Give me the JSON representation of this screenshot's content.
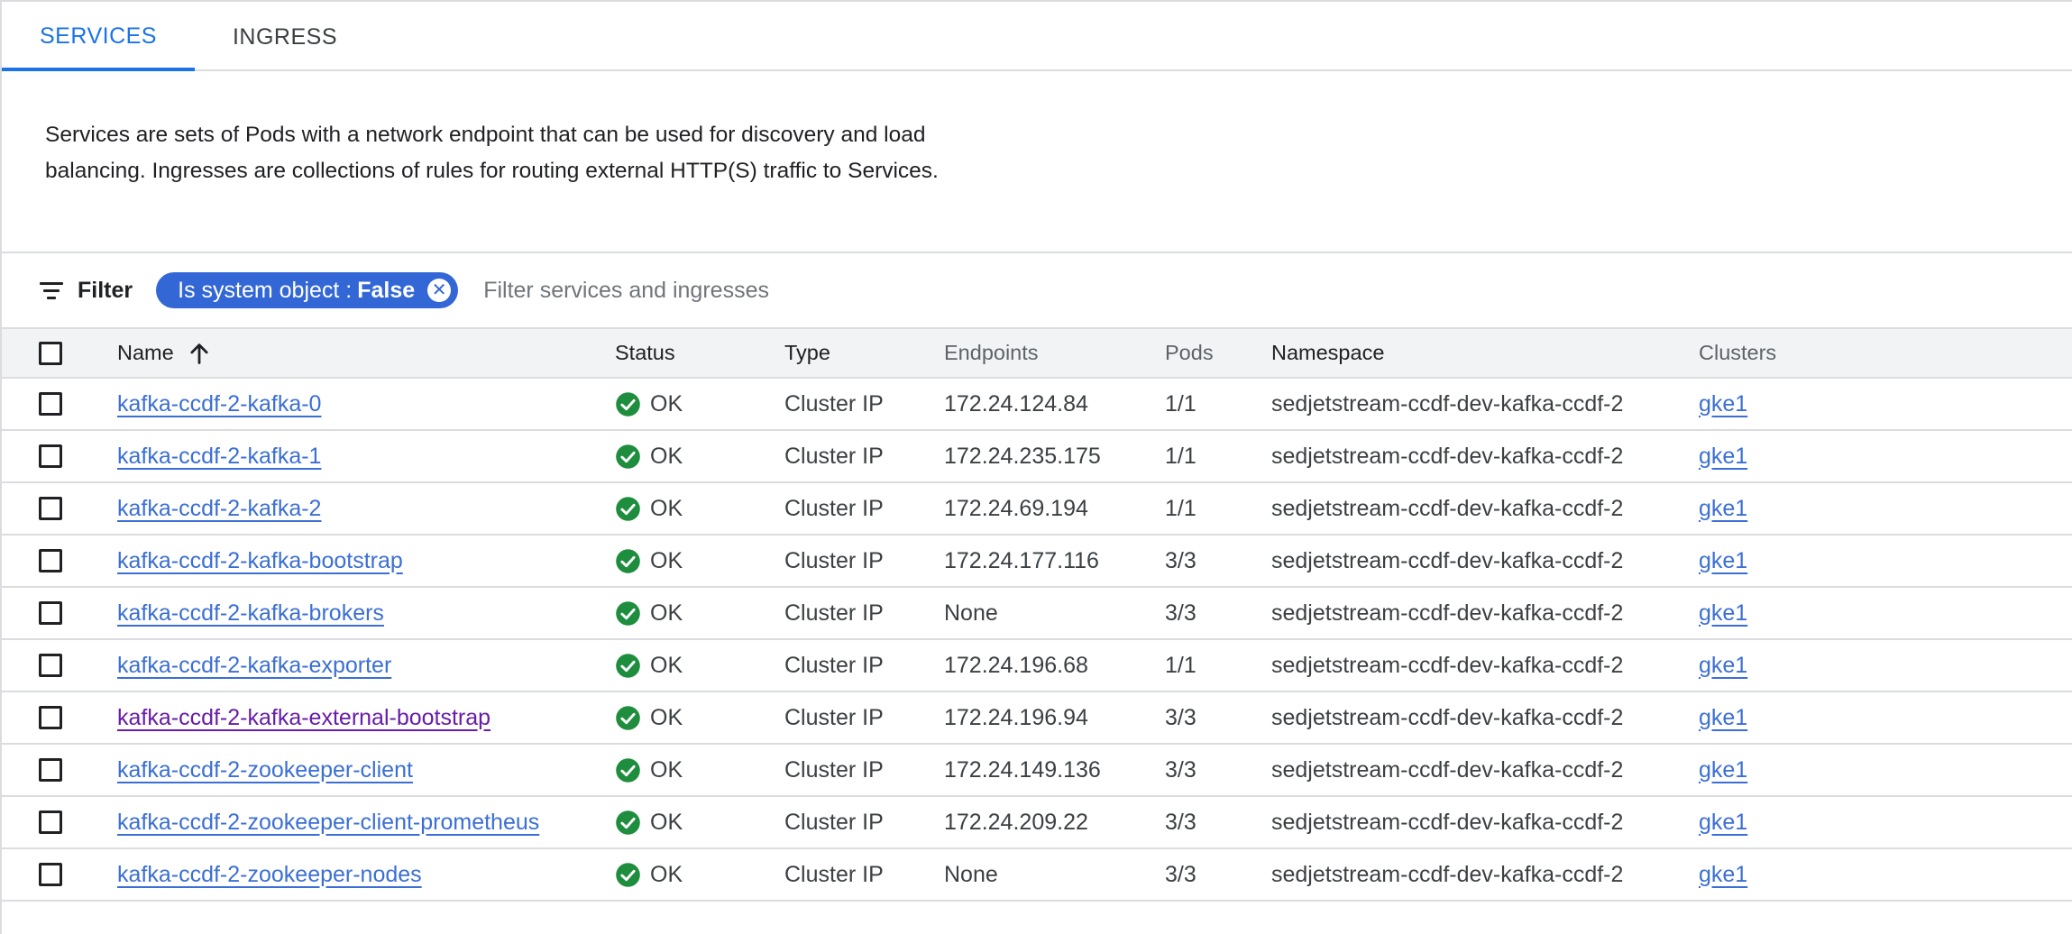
{
  "tabs": [
    {
      "label": "SERVICES",
      "active": true
    },
    {
      "label": "INGRESS",
      "active": false
    }
  ],
  "description": "Services are sets of Pods with a network endpoint that can be used for discovery and load balancing. Ingresses are collections of rules for routing external HTTP(S) traffic to Services.",
  "filter": {
    "label": "Filter",
    "chip_key": "Is system object :",
    "chip_value": "False",
    "placeholder": "Filter services and ingresses"
  },
  "table": {
    "headers": {
      "name": "Name",
      "status": "Status",
      "type": "Type",
      "endpoints": "Endpoints",
      "pods": "Pods",
      "namespace": "Namespace",
      "clusters": "Clusters"
    },
    "sort": {
      "column": "Name",
      "direction": "ascending"
    },
    "rows": [
      {
        "name": "kafka-ccdf-2-kafka-0",
        "status": "OK",
        "type": "Cluster IP",
        "endpoints": "172.24.124.84",
        "pods": "1/1",
        "namespace": "sedjetstream-ccdf-dev-kafka-ccdf-2",
        "cluster": "gke1"
      },
      {
        "name": "kafka-ccdf-2-kafka-1",
        "status": "OK",
        "type": "Cluster IP",
        "endpoints": "172.24.235.175",
        "pods": "1/1",
        "namespace": "sedjetstream-ccdf-dev-kafka-ccdf-2",
        "cluster": "gke1"
      },
      {
        "name": "kafka-ccdf-2-kafka-2",
        "status": "OK",
        "type": "Cluster IP",
        "endpoints": "172.24.69.194",
        "pods": "1/1",
        "namespace": "sedjetstream-ccdf-dev-kafka-ccdf-2",
        "cluster": "gke1"
      },
      {
        "name": "kafka-ccdf-2-kafka-bootstrap",
        "status": "OK",
        "type": "Cluster IP",
        "endpoints": "172.24.177.116",
        "pods": "3/3",
        "namespace": "sedjetstream-ccdf-dev-kafka-ccdf-2",
        "cluster": "gke1"
      },
      {
        "name": "kafka-ccdf-2-kafka-brokers",
        "status": "OK",
        "type": "Cluster IP",
        "endpoints": "None",
        "pods": "3/3",
        "namespace": "sedjetstream-ccdf-dev-kafka-ccdf-2",
        "cluster": "gke1"
      },
      {
        "name": "kafka-ccdf-2-kafka-exporter",
        "status": "OK",
        "type": "Cluster IP",
        "endpoints": "172.24.196.68",
        "pods": "1/1",
        "namespace": "sedjetstream-ccdf-dev-kafka-ccdf-2",
        "cluster": "gke1"
      },
      {
        "name": "kafka-ccdf-2-kafka-external-bootstrap",
        "status": "OK",
        "type": "Cluster IP",
        "endpoints": "172.24.196.94",
        "pods": "3/3",
        "namespace": "sedjetstream-ccdf-dev-kafka-ccdf-2",
        "cluster": "gke1",
        "visited": true
      },
      {
        "name": "kafka-ccdf-2-zookeeper-client",
        "status": "OK",
        "type": "Cluster IP",
        "endpoints": "172.24.149.136",
        "pods": "3/3",
        "namespace": "sedjetstream-ccdf-dev-kafka-ccdf-2",
        "cluster": "gke1"
      },
      {
        "name": "kafka-ccdf-2-zookeeper-client-prometheus",
        "status": "OK",
        "type": "Cluster IP",
        "endpoints": "172.24.209.22",
        "pods": "3/3",
        "namespace": "sedjetstream-ccdf-dev-kafka-ccdf-2",
        "cluster": "gke1"
      },
      {
        "name": "kafka-ccdf-2-zookeeper-nodes",
        "status": "OK",
        "type": "Cluster IP",
        "endpoints": "None",
        "pods": "3/3",
        "namespace": "sedjetstream-ccdf-dev-kafka-ccdf-2",
        "cluster": "gke1"
      }
    ]
  },
  "colors": {
    "accent": "#1a73e8",
    "link": "#3b6fd4",
    "visited_link": "#681da8",
    "ok_green": "#1e8e3e",
    "chip": "#3367d6"
  },
  "icons": {
    "filter": "filter-lines-icon",
    "sort": "arrow-up-icon",
    "status_ok": "check-circle-icon",
    "chip_remove": "close-circle-icon"
  }
}
